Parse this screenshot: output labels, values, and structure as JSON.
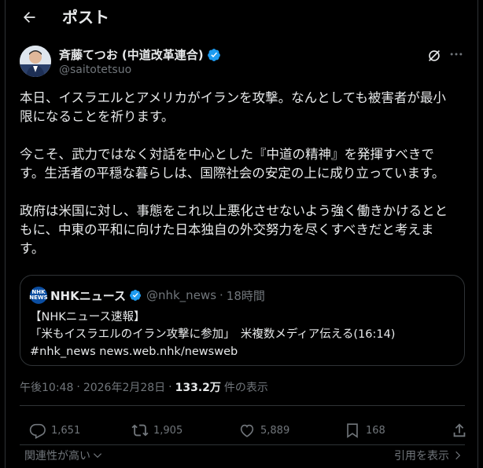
{
  "header": {
    "title": "ポスト"
  },
  "author": {
    "name": "斉藤てつお (中道改革連合)",
    "handle": "@saitotetsuo"
  },
  "post": {
    "text": "本日、イスラエルとアメリカがイランを攻撃。なんとしても被害者が最小\n限になることを祈ります。\n\n今こそ、武力ではなく対話を中心とした『中道の精神』を発揮すべきで\nす。生活者の平穏な暮らしは、国際社会の安定の上に成り立っています。\n\n政府は米国に対し、事態をこれ以上悪化させないよう強く働きかけるとと\nもに、中東の平和に向けた日本独自の外交努力を尽くすべきだと考えま\nす。"
  },
  "quote": {
    "logo": "NHK NEWS",
    "name": "NHKニュース",
    "handle": "@nhk_news",
    "separator": "·",
    "time": "18時間",
    "line1": "【NHKニュース速報】",
    "line2": "「米もイスラエルのイラン攻撃に参加」　米複数メディア伝える(16:14)",
    "line3": "#nhk_news news.web.nhk/newsweb"
  },
  "meta": {
    "time": "午後10:48",
    "separator1": "·",
    "date": "2026年2月28日",
    "separator2": "·",
    "views": "133.2万",
    "views_label": "件の表示"
  },
  "actions": {
    "replies": "1,651",
    "reposts": "1,905",
    "likes": "5,889",
    "bookmarks": "168"
  },
  "footer": {
    "sort": "関連性が高い",
    "quotes": "引用を表示"
  },
  "colors": {
    "background": "#000000",
    "text": "#e7e9ea",
    "muted": "#71767b",
    "verified": "#1d9bf0",
    "border": "#2f3336"
  }
}
